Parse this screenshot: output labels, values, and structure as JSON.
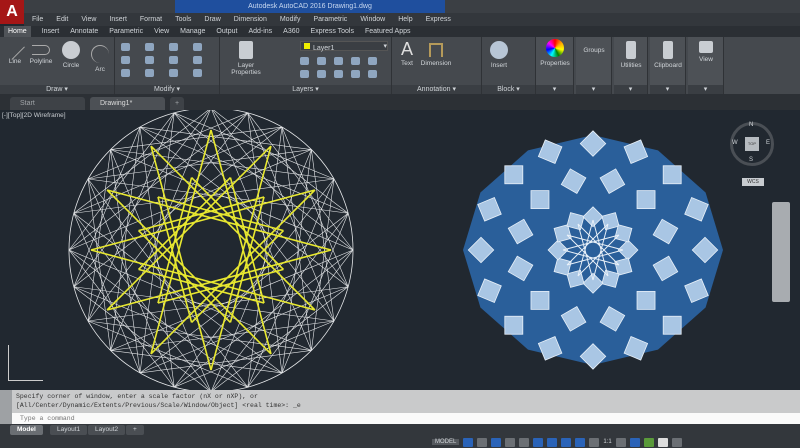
{
  "app": {
    "title": "Autodesk AutoCAD 2016  Drawing1.dwg",
    "logo": "A",
    "accent": "#1f4f9e"
  },
  "menu": [
    "File",
    "Edit",
    "View",
    "Insert",
    "Format",
    "Tools",
    "Draw",
    "Dimension",
    "Modify",
    "Parametric",
    "Window",
    "Help",
    "Express"
  ],
  "ribbon_tabs": [
    "Home",
    "Insert",
    "Annotate",
    "Parametric",
    "View",
    "Manage",
    "Output",
    "Add-ins",
    "A360",
    "Express Tools",
    "Featured Apps"
  ],
  "ribbon": {
    "draw": {
      "label": "Draw",
      "tools": [
        "Line",
        "Polyline",
        "Circle",
        "Arc"
      ]
    },
    "modify": {
      "label": "Modify"
    },
    "layers": {
      "label": "Layers",
      "tool": "Layer Properties",
      "current_layer": "Layer1"
    },
    "annotation": {
      "label": "Annotation",
      "tools": [
        "Text",
        "Dimension"
      ]
    },
    "block": {
      "label": "Block",
      "tool": "Insert"
    },
    "others": [
      "Properties",
      "Groups",
      "Utilities",
      "Clipboard",
      "View"
    ]
  },
  "file_tabs": [
    "Start",
    "Drawing1*"
  ],
  "viewport": {
    "label": "[-][Top][2D Wireframe]",
    "viewcube": {
      "top": "TOP",
      "n": "N",
      "s": "S",
      "e": "E",
      "w": "W",
      "wcs": "WCS"
    },
    "colors": {
      "wire": "#e6e8ea",
      "star": "#e8e830",
      "fill": "#2a5f9a",
      "tile": "#a9c6e4"
    }
  },
  "command": {
    "history": [
      "Specify corner of window, enter a scale factor (nX or nXP), or",
      "[All/Center/Dynamic/Extents/Previous/Scale/Window/Object] <real time>: _e"
    ],
    "placeholder": "Type a command"
  },
  "layout_tabs": [
    "Model",
    "Layout1",
    "Layout2"
  ],
  "status": {
    "model": "MODEL",
    "scale": "1:1"
  }
}
